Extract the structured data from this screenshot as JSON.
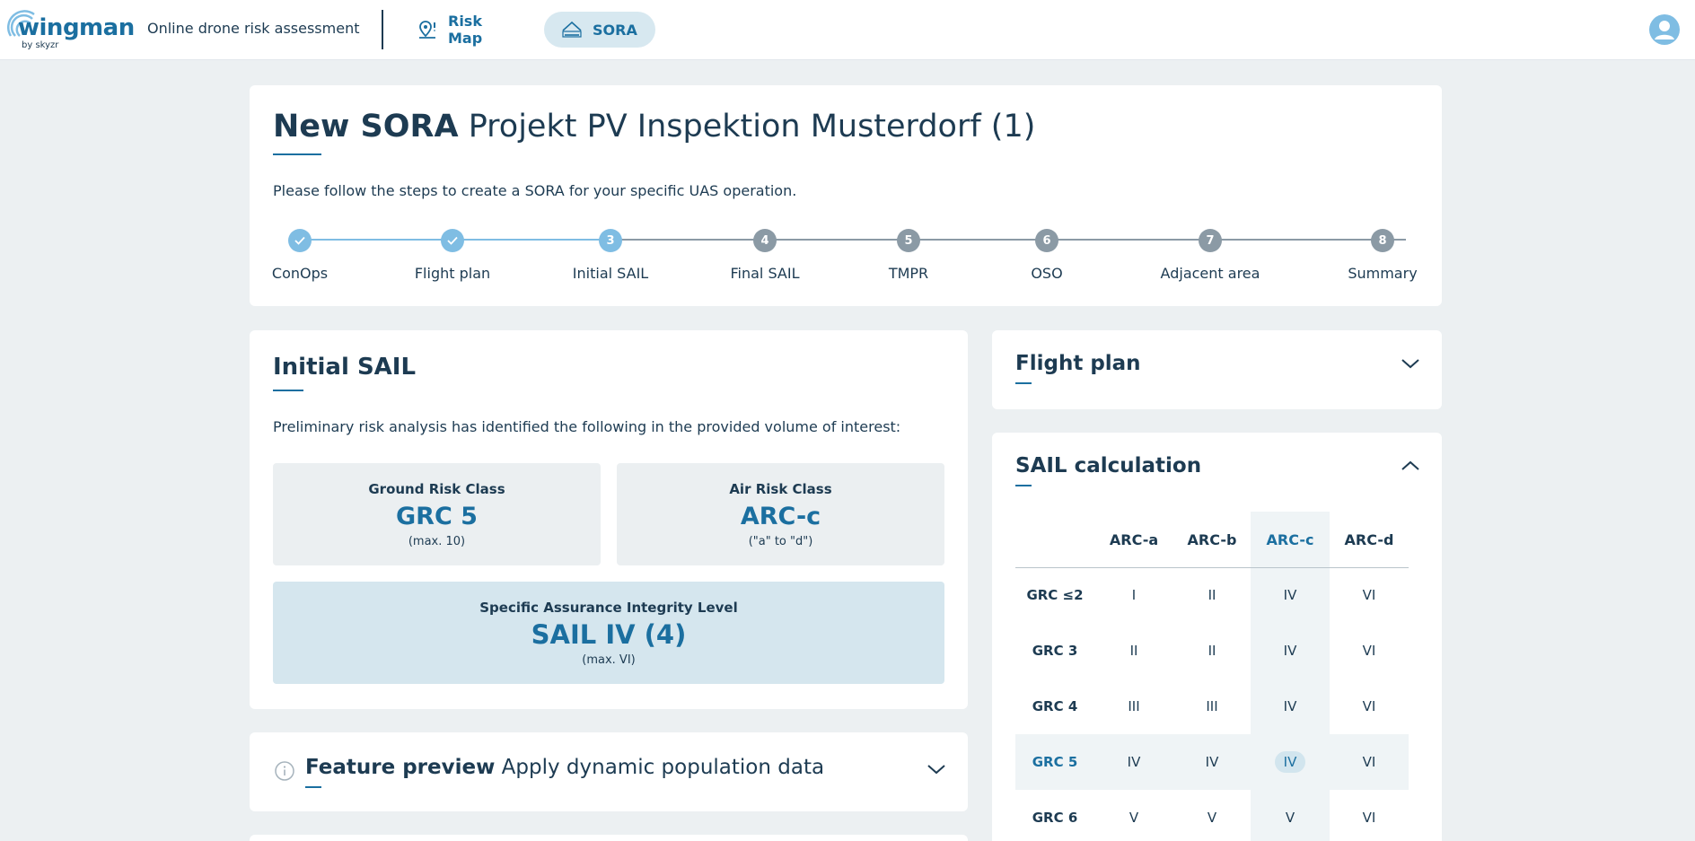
{
  "header": {
    "logo_word": "wingman",
    "logo_sub": "by skyzr",
    "subtitle": "Online drone risk assessment",
    "nav": [
      {
        "label": "Risk Map",
        "icon": "map-pin-icon"
      },
      {
        "label": "SORA",
        "icon": "sora-icon"
      }
    ],
    "avatar_icon": "user-avatar-icon"
  },
  "project": {
    "title_bold": "New SORA",
    "title_rest": " Projekt PV Inspektion Musterdorf (1)",
    "intro": "Please follow the steps to create a SORA for your specific UAS operation."
  },
  "steps": [
    {
      "number": "1",
      "label": "ConOps",
      "state": "done"
    },
    {
      "number": "2",
      "label": "Flight plan",
      "state": "done"
    },
    {
      "number": "3",
      "label": "Initial SAIL",
      "state": "active"
    },
    {
      "number": "4",
      "label": "Final SAIL",
      "state": "todo"
    },
    {
      "number": "5",
      "label": "TMPR",
      "state": "todo"
    },
    {
      "number": "6",
      "label": "OSO",
      "state": "todo"
    },
    {
      "number": "7",
      "label": "Adjacent area",
      "state": "todo"
    },
    {
      "number": "8",
      "label": "Summary",
      "state": "todo"
    }
  ],
  "initial_sail": {
    "title": "Initial SAIL",
    "description": "Preliminary risk analysis has identified the following in the provided volume of interest:",
    "grc": {
      "label": "Ground Risk Class",
      "value": "GRC 5",
      "note": "(max. 10)"
    },
    "arc": {
      "label": "Air Risk Class",
      "value": "ARC-c",
      "note": "(\"a\" to \"d\")"
    },
    "sail": {
      "label": "Specific Assurance Integrity Level",
      "value": "SAIL IV (4)",
      "note": "(max. VI)"
    }
  },
  "feature_preview": {
    "title_bold": "Feature preview",
    "title_rest": " Apply dynamic population data"
  },
  "flight_plan_panel": {
    "title": "Flight plan"
  },
  "sail_calc": {
    "title": "SAIL calculation",
    "columns": [
      "ARC-a",
      "ARC-b",
      "ARC-c",
      "ARC-d"
    ],
    "highlight_column": 2,
    "highlight_row": 3,
    "rows": [
      {
        "label": "GRC ≤2",
        "cells": [
          "I",
          "II",
          "IV",
          "VI"
        ]
      },
      {
        "label": "GRC 3",
        "cells": [
          "II",
          "II",
          "IV",
          "VI"
        ]
      },
      {
        "label": "GRC 4",
        "cells": [
          "III",
          "III",
          "IV",
          "VI"
        ]
      },
      {
        "label": "GRC 5",
        "cells": [
          "IV",
          "IV",
          "IV",
          "VI"
        ]
      },
      {
        "label": "GRC 6",
        "cells": [
          "V",
          "V",
          "V",
          "VI"
        ]
      }
    ]
  },
  "colors": {
    "accent": "#1b6fa0",
    "step_done": "#7fbde3",
    "step_todo": "#8b9aa5",
    "highlight_bg": "#d5e6ee"
  }
}
